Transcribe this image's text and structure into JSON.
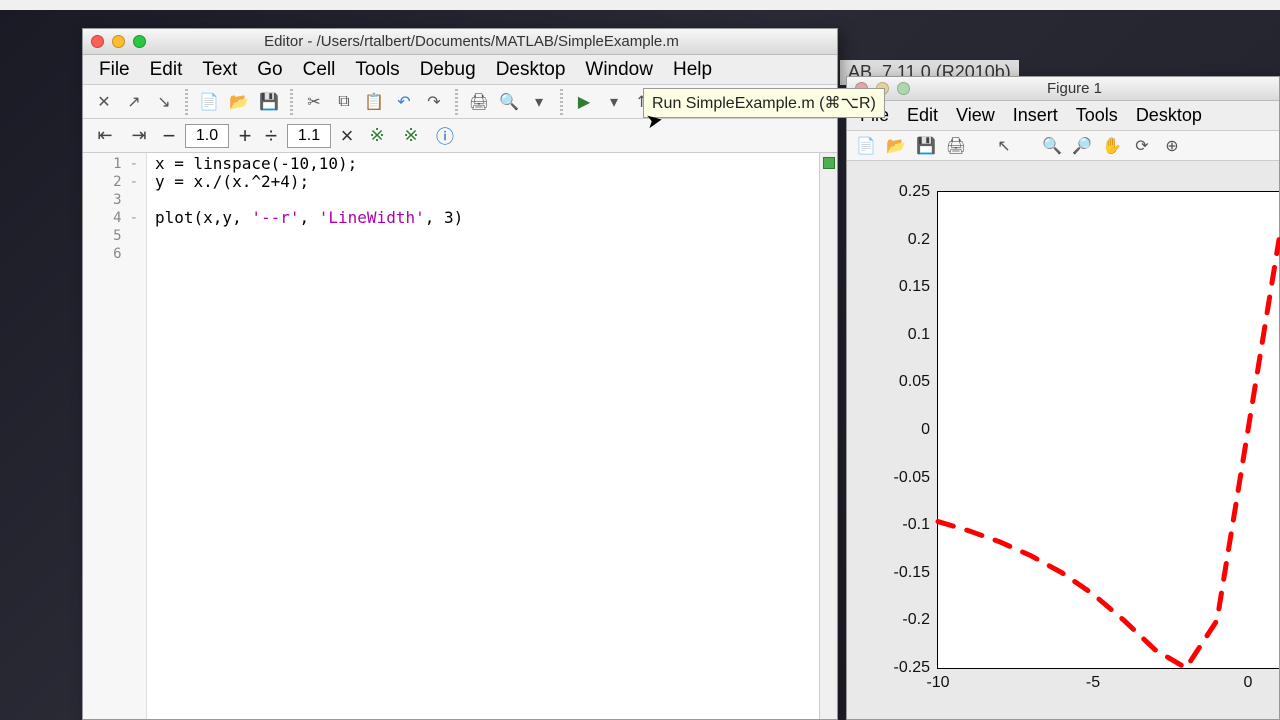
{
  "app_name": "MATLAB",
  "background_hint": "AB_7.11.0 (R2010b)",
  "editor": {
    "title": "Editor - /Users/rtalbert/Documents/MATLAB/SimpleExample.m",
    "menus": [
      "File",
      "Edit",
      "Text",
      "Go",
      "Cell",
      "Tools",
      "Debug",
      "Desktop",
      "Window",
      "Help"
    ],
    "tooltip": "Run SimpleExample.m (⌘⌥R)",
    "cell_field_1": "1.0",
    "cell_field_2": "1.1",
    "code_lines": [
      {
        "n": "1",
        "dash": "-",
        "text": "x = linspace(-10,10);"
      },
      {
        "n": "2",
        "dash": "-",
        "text": "y = x./(x.^2+4);"
      },
      {
        "n": "3",
        "dash": "",
        "text": ""
      },
      {
        "n": "4",
        "dash": "-",
        "text": "plot(x,y, '--r', 'LineWidth', 3)"
      },
      {
        "n": "5",
        "dash": "",
        "text": ""
      },
      {
        "n": "6",
        "dash": "",
        "text": ""
      }
    ],
    "strings_in_line4": [
      "'--r'",
      "'LineWidth'"
    ]
  },
  "figure": {
    "title": "Figure 1",
    "menus": [
      "File",
      "Edit",
      "View",
      "Insert",
      "Tools",
      "Desktop"
    ],
    "yticks": [
      "0.25",
      "0.2",
      "0.15",
      "0.1",
      "0.05",
      "0",
      "-0.05",
      "-0.1",
      "-0.15",
      "-0.2",
      "-0.25"
    ],
    "xticks": [
      "-10",
      "-5",
      "0"
    ]
  },
  "chart_data": {
    "type": "line",
    "title": "",
    "xlabel": "",
    "ylabel": "",
    "xlim": [
      -10,
      10
    ],
    "ylim": [
      -0.25,
      0.25
    ],
    "visible_xlim": [
      -10,
      1
    ],
    "line_style": "--r",
    "line_width": 3,
    "formula": "y = x / (x^2 + 4)",
    "series": [
      {
        "name": "y = x/(x^2+4)",
        "x": [
          -10,
          -9,
          -8,
          -7,
          -6,
          -5,
          -4,
          -3,
          -2,
          -1,
          0,
          1
        ],
        "y": [
          -0.0962,
          -0.1059,
          -0.1176,
          -0.1321,
          -0.15,
          -0.1724,
          -0.2,
          -0.2308,
          -0.25,
          -0.2,
          0.0,
          0.2
        ]
      }
    ]
  }
}
